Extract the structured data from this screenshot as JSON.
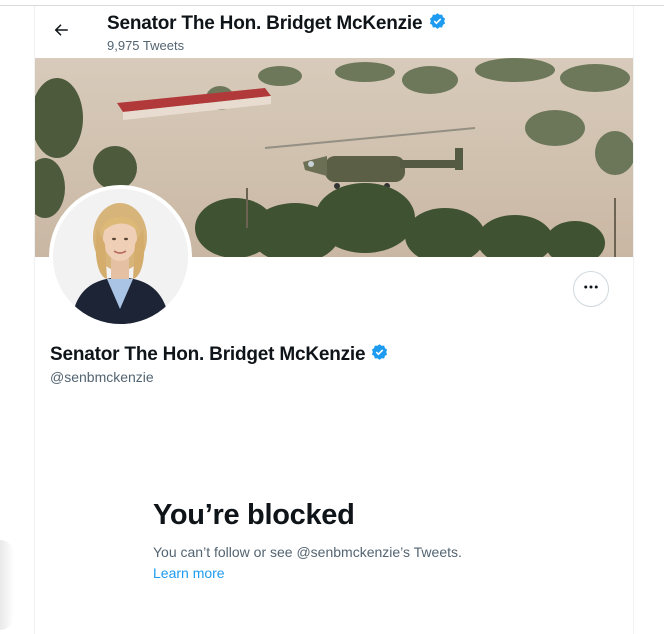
{
  "header": {
    "back_icon": "arrow-left-icon",
    "title": "Senator The Hon. Bridget McKenzie",
    "tweet_count": "9,975 Tweets",
    "verified_icon": "verified-badge-icon"
  },
  "profile": {
    "banner_description": "banner-image",
    "avatar_description": "avatar",
    "more_icon": "more-horizontal-icon",
    "display_name": "Senator The Hon. Bridget McKenzie",
    "handle": "@senbmckenzie"
  },
  "blocked": {
    "title": "You’re blocked",
    "message": "You can’t follow or see @senbmckenzie’s Tweets.",
    "learn_more": "Learn more"
  },
  "colors": {
    "accent": "#1d9bf0",
    "text": "#0f1419",
    "secondary_text": "#536471",
    "border": "#cfd9de"
  }
}
